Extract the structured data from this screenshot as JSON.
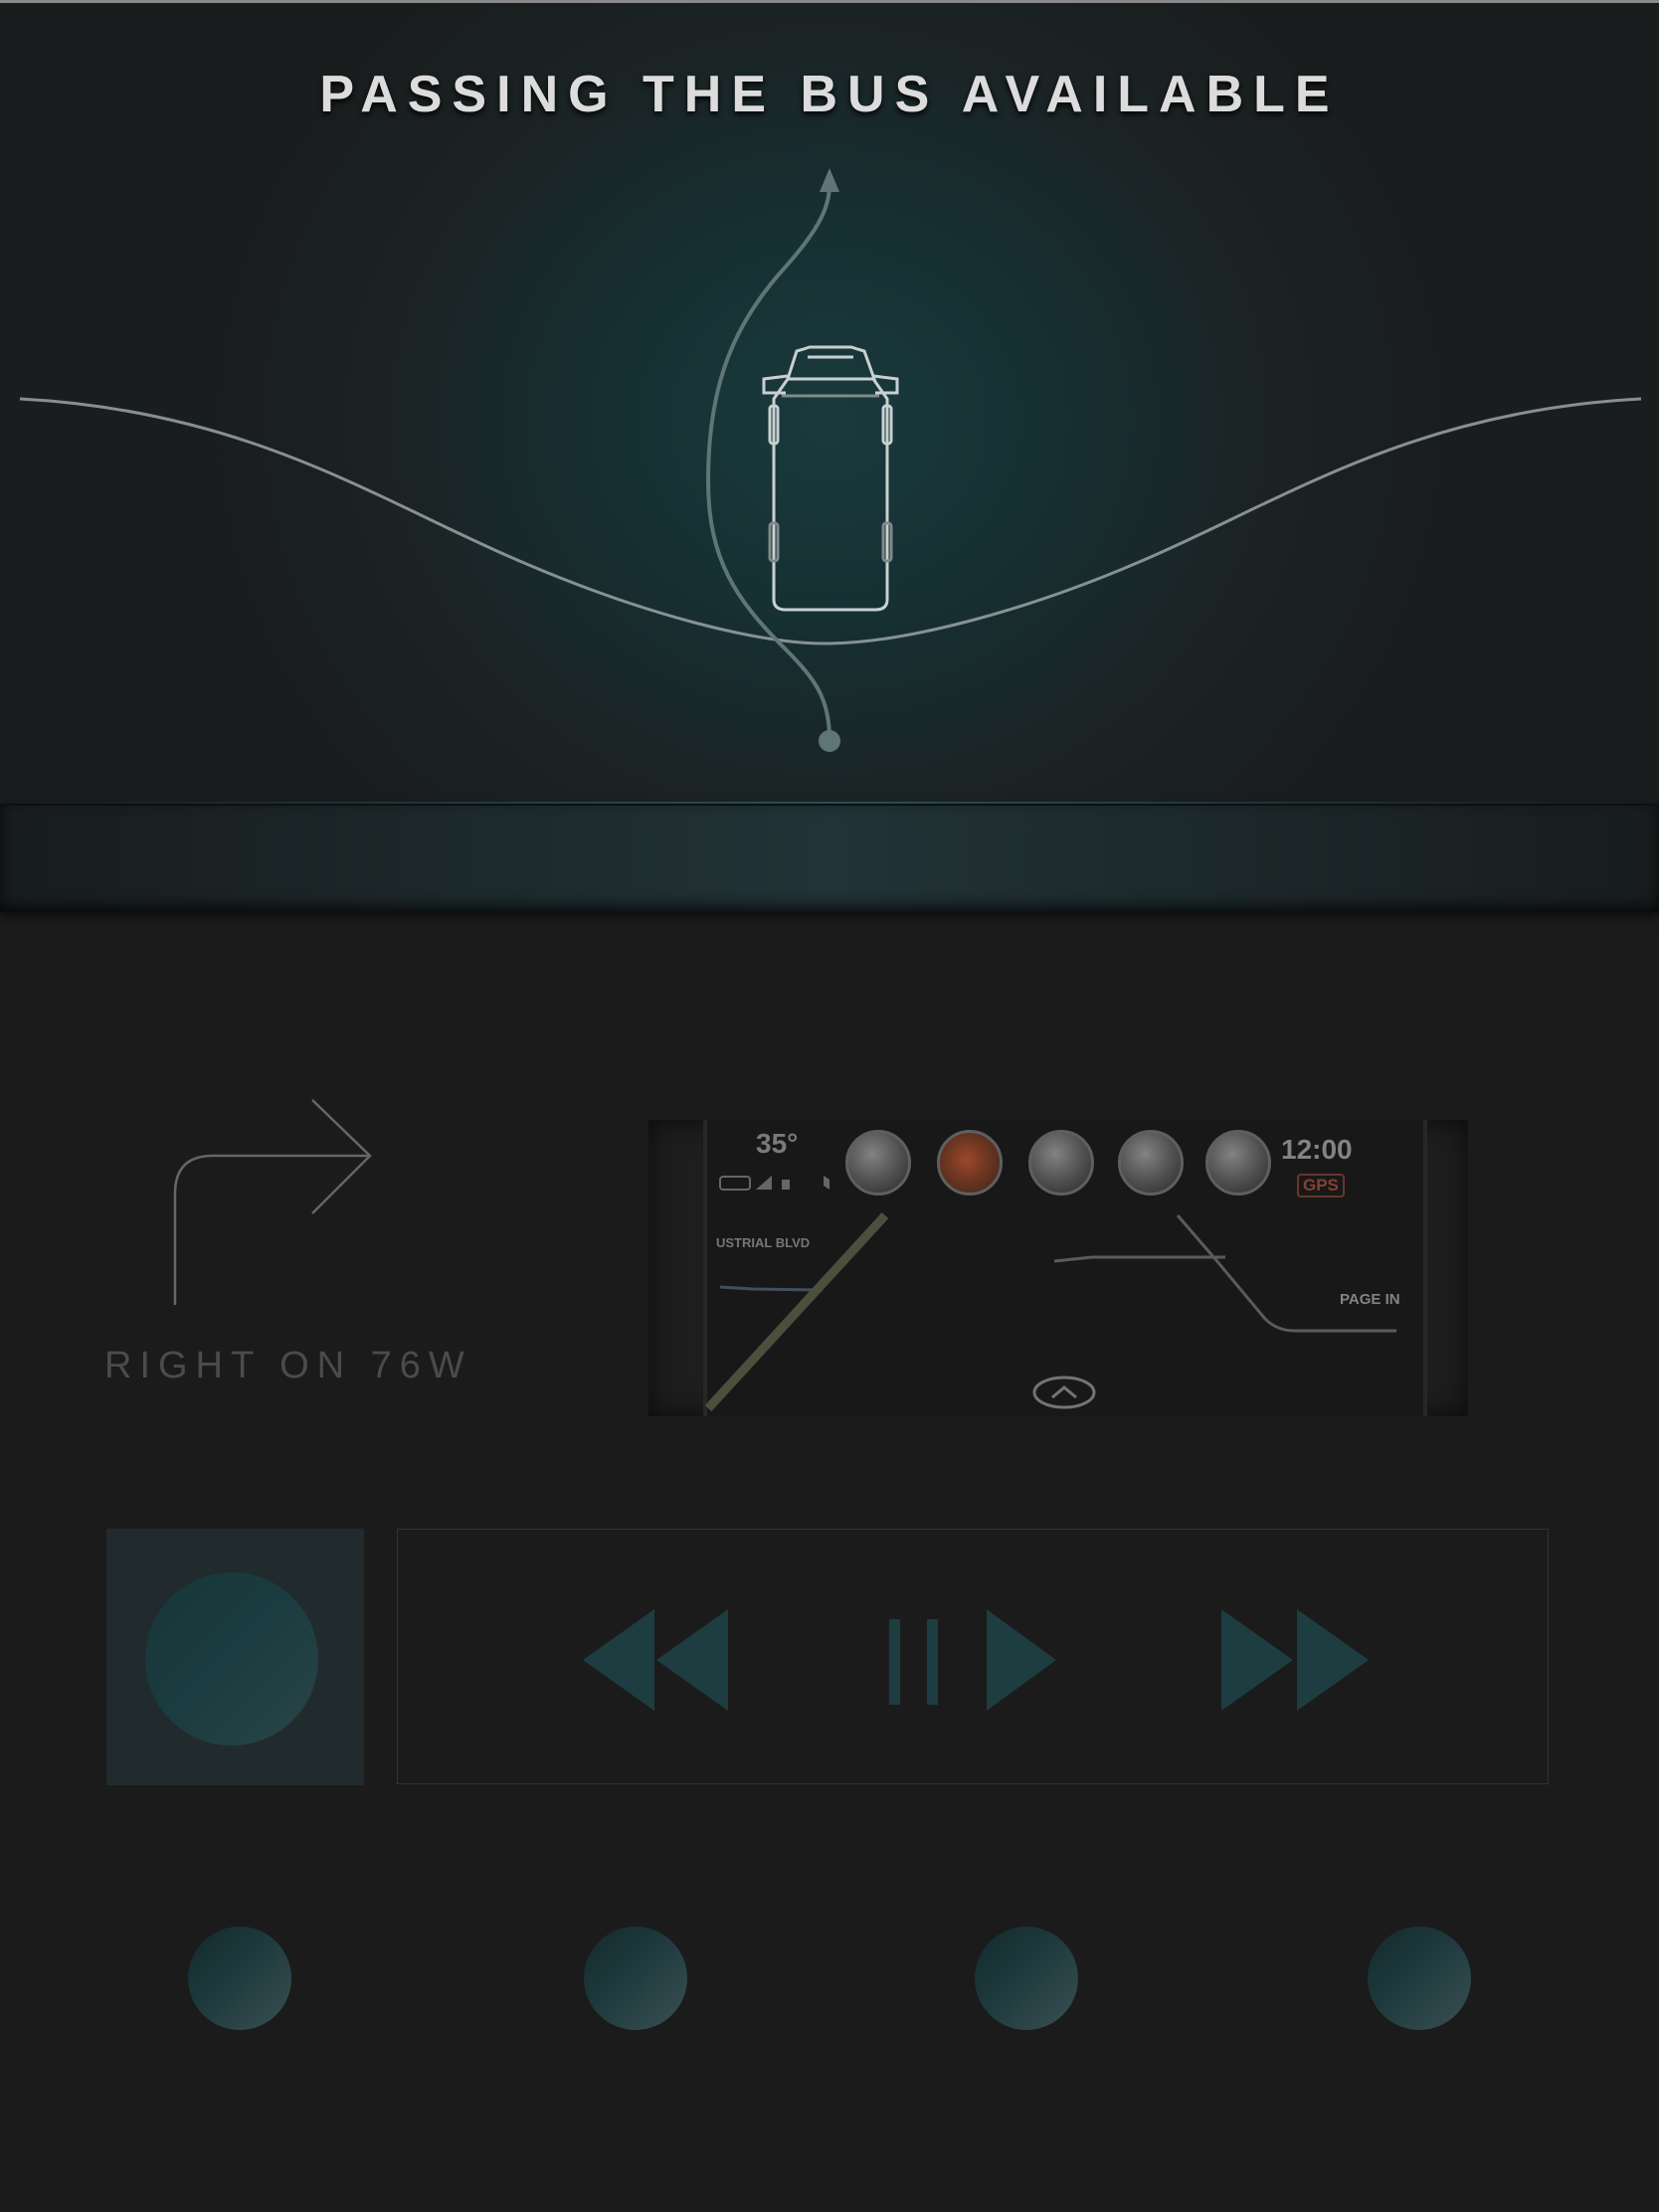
{
  "hero": {
    "title": "PASSING THE BUS AVAILABLE"
  },
  "direction": {
    "instruction": "RIGHT ON 76W",
    "icon": "turn-right-arrow-icon"
  },
  "dashboard": {
    "temperature": "35°",
    "clock": "12:00",
    "gps_badge": "GPS",
    "road_left": "USTRIAL BLVD",
    "road_right": "PAGE IN",
    "apps": [
      "phone-icon",
      "maps-icon",
      "compass-icon",
      "music-icon",
      "settings-icon"
    ],
    "home_icon": "chevron-up-icon"
  },
  "media": {
    "album_icon": "album-art-disc",
    "buttons": [
      "rewind-icon",
      "play-pause-icon",
      "fast-forward-icon"
    ],
    "accent": "#1d3d41"
  },
  "bottom_buttons": [
    "round-button-1",
    "round-button-2",
    "round-button-3",
    "round-button-4"
  ],
  "colors": {
    "background": "#1b1b1b",
    "accent_teal": "#1d3d41",
    "title": "#dcdcdc"
  }
}
